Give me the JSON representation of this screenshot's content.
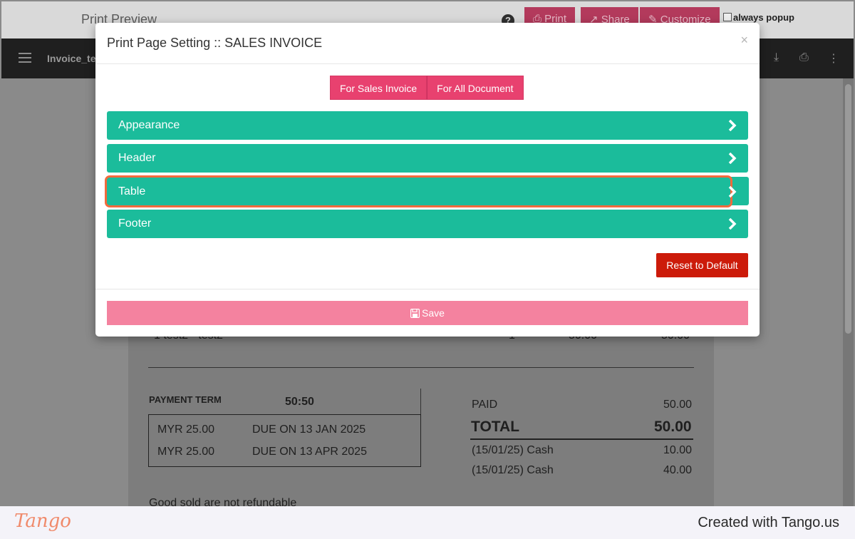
{
  "background": {
    "title": "Print Preview",
    "help_icon": "question-circle-icon",
    "buttons": [
      {
        "label": "Print",
        "icon": "print-icon"
      },
      {
        "label": "Share",
        "icon": "share-icon"
      },
      {
        "label": "Customize",
        "icon": "brush-icon"
      }
    ],
    "always_popup_label": "always popup",
    "viewer": {
      "filename": "Invoice_te",
      "icons": [
        "menu-icon",
        "download-icon",
        "print-icon",
        "more-vert-icon"
      ]
    },
    "document": {
      "row_text": "1   test2 - test2",
      "row_qty": "1",
      "row_price": "50.00",
      "row_amount": "50.00",
      "payment_term_label": "PAYMENT TERM",
      "payment_term_value": "50:50",
      "installments": [
        {
          "amount": "MYR 25.00",
          "due": "DUE ON 13 JAN 2025"
        },
        {
          "amount": "MYR 25.00",
          "due": "DUE ON 13 APR 2025"
        }
      ],
      "paid_label": "PAID",
      "paid_value": "50.00",
      "total_label": "TOTAL",
      "total_value": "50.00",
      "payments": [
        {
          "label": "(15/01/25) Cash",
          "value": "10.00"
        },
        {
          "label": "(15/01/25) Cash",
          "value": "40.00"
        }
      ],
      "note": "Good sold are not refundable"
    }
  },
  "modal": {
    "title": "Print Page Setting :: SALES INVOICE",
    "close": "×",
    "toggles": [
      "For Sales Invoice",
      "For All Document"
    ],
    "sections": [
      "Appearance",
      "Header",
      "Table",
      "Footer"
    ],
    "reset_label": "Reset to Default",
    "save_label": "Save"
  },
  "tango": {
    "logo": "Tango",
    "credit": "Created with Tango.us"
  },
  "colors": {
    "accent_pink": "#e8416f",
    "section_green": "#1bbc9b",
    "reset_red": "#cc1b0a",
    "save_pink": "#f4829f",
    "highlight_orange": "#f26a3c"
  }
}
